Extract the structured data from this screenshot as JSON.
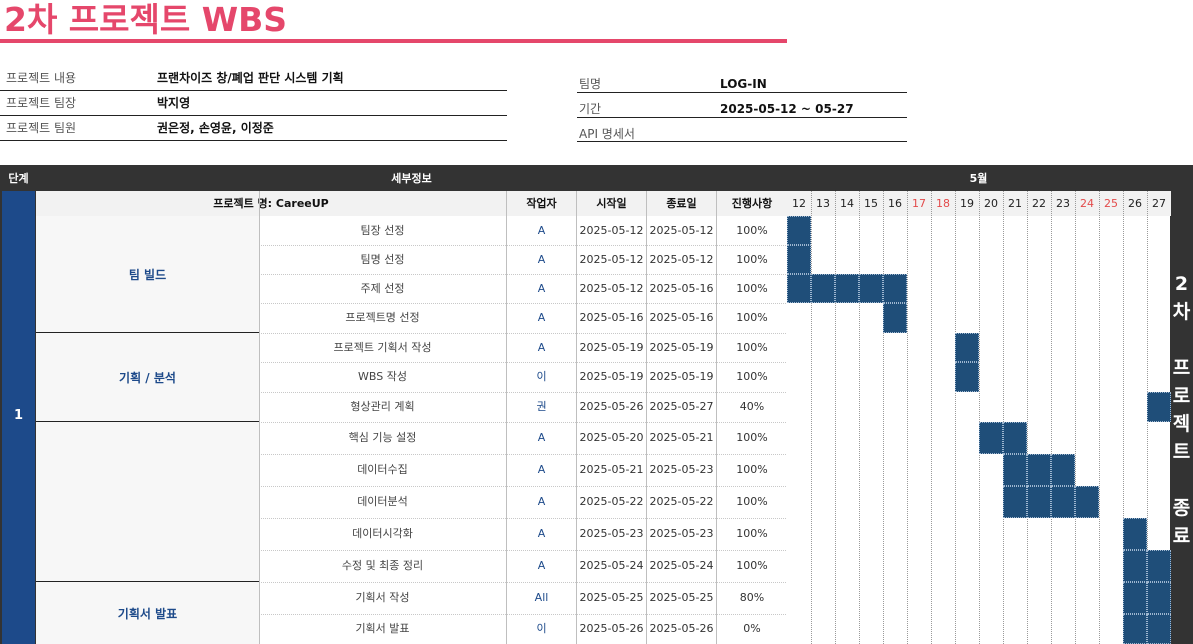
{
  "title": "2차 프로젝트 WBS",
  "info": {
    "project_content_label": "프로젝트 내용",
    "project_content": "프랜차이즈 창/폐업 판단 시스템 기획",
    "leader_label": "프로젝트 팀장",
    "leader": "박지영",
    "members_label": "프로젝트 팀원",
    "members": "권은정, 손영윤, 이정준",
    "team_label": "팀명",
    "team": "LOG-IN",
    "period_label": "기간",
    "period": "2025-05-12 ~ 05-27",
    "api_label": "API 명세서"
  },
  "headers": {
    "stage": "단계",
    "detail": "세부정보",
    "month": "5월",
    "project_name": "프로젝트 명: CareeUP",
    "worker": "작업자",
    "start": "시작일",
    "end": "종료일",
    "progress": "진행사항"
  },
  "stage_number": "1",
  "days": [
    "12",
    "13",
    "14",
    "15",
    "16",
    "17",
    "18",
    "19",
    "20",
    "21",
    "22",
    "23",
    "24",
    "25",
    "26",
    "27"
  ],
  "weekend_days": [
    "17",
    "18",
    "24",
    "25"
  ],
  "groups": [
    {
      "name": "팀 빌드",
      "rows": 4
    },
    {
      "name": "기획 / 분석",
      "rows": 3
    },
    {
      "name": "",
      "rows": 5
    },
    {
      "name": "기획서 발표",
      "rows": 2
    }
  ],
  "tasks": [
    {
      "name": "팀장 선정",
      "worker": "A",
      "start": "2025-05-12",
      "end": "2025-05-12",
      "progress": "100%"
    },
    {
      "name": "팀명 선정",
      "worker": "A",
      "start": "2025-05-12",
      "end": "2025-05-12",
      "progress": "100%"
    },
    {
      "name": "주제 선정",
      "worker": "A",
      "start": "2025-05-12",
      "end": "2025-05-16",
      "progress": "100%"
    },
    {
      "name": "프로젝트명 선정",
      "worker": "A",
      "start": "2025-05-16",
      "end": "2025-05-16",
      "progress": "100%"
    },
    {
      "name": "프로젝트 기획서 작성",
      "worker": "A",
      "start": "2025-05-19",
      "end": "2025-05-19",
      "progress": "100%"
    },
    {
      "name": "WBS 작성",
      "worker": "이",
      "start": "2025-05-19",
      "end": "2025-05-19",
      "progress": "100%"
    },
    {
      "name": "형상관리 계획",
      "worker": "권",
      "start": "2025-05-26",
      "end": "2025-05-27",
      "progress": "40%"
    },
    {
      "name": "핵심 기능 설정",
      "worker": "A",
      "start": "2025-05-20",
      "end": "2025-05-21",
      "progress": "100%"
    },
    {
      "name": "데이터수집",
      "worker": "A",
      "start": "2025-05-21",
      "end": "2025-05-23",
      "progress": "100%"
    },
    {
      "name": "데이터분석",
      "worker": "A",
      "start": "2025-05-22",
      "end": "2025-05-22",
      "progress": "100%"
    },
    {
      "name": "데이터시각화",
      "worker": "A",
      "start": "2025-05-23",
      "end": "2025-05-23",
      "progress": "100%"
    },
    {
      "name": "수정 및 최종 정리",
      "worker": "A",
      "start": "2025-05-24",
      "end": "2025-05-24",
      "progress": "100%"
    },
    {
      "name": "기획서 작성",
      "worker": "All",
      "start": "2025-05-25",
      "end": "2025-05-25",
      "progress": "80%"
    },
    {
      "name": "기획서 발표",
      "worker": "이",
      "start": "2025-05-26",
      "end": "2025-05-26",
      "progress": "0%"
    }
  ],
  "gantt_fills": [
    [
      "12"
    ],
    [
      "12"
    ],
    [
      "12",
      "13",
      "14",
      "15",
      "16"
    ],
    [
      "16"
    ],
    [
      "19"
    ],
    [
      "19"
    ],
    [
      "27"
    ],
    [
      "20",
      "21"
    ],
    [
      "21",
      "22",
      "23"
    ],
    [
      "21",
      "22",
      "23",
      "24"
    ],
    [
      "26"
    ],
    [
      "26",
      "27"
    ],
    [
      "26",
      "27"
    ],
    [
      "26",
      "27"
    ]
  ],
  "side_text": [
    "2",
    "차",
    "",
    "프",
    "로",
    "젝",
    "트",
    "",
    "종",
    "료"
  ],
  "colors": {
    "accent": "#e5476b",
    "stage": "#1d4a8a",
    "bar": "#1f4e79",
    "weekend": "#e34b4b"
  }
}
